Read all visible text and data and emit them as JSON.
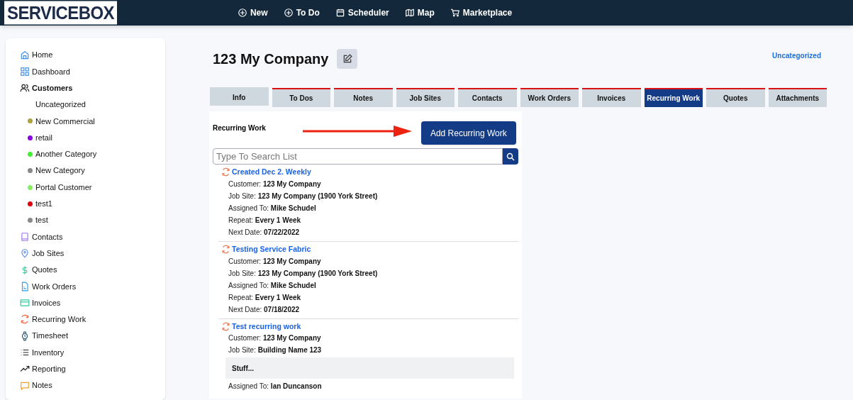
{
  "logo": "SERVICEBOX",
  "top_nav": [
    {
      "label": "New"
    },
    {
      "label": "To Do"
    },
    {
      "label": "Scheduler"
    },
    {
      "label": "Map"
    },
    {
      "label": "Marketplace"
    }
  ],
  "sidebar": {
    "items": [
      {
        "label": "Home",
        "selected": false
      },
      {
        "label": "Dashboard",
        "selected": false
      },
      {
        "label": "Customers",
        "selected": true,
        "children": [
          {
            "label": "Uncategorized"
          },
          {
            "label": "New Commercial",
            "color": "#b0a040"
          },
          {
            "label": "retail",
            "color": "#8a00e0"
          },
          {
            "label": "Another Category",
            "color": "#44ee33"
          },
          {
            "label": "New Category",
            "color": "#888888"
          },
          {
            "label": "Portal Customer",
            "color": "#88ee66"
          },
          {
            "label": "test1",
            "color": "#dd0011"
          },
          {
            "label": "test",
            "color": "#888888"
          }
        ]
      },
      {
        "label": "Contacts",
        "selected": false
      },
      {
        "label": "Job Sites",
        "selected": false
      },
      {
        "label": "Quotes",
        "selected": false
      },
      {
        "label": "Work Orders",
        "selected": false
      },
      {
        "label": "Invoices",
        "selected": false
      },
      {
        "label": "Recurring Work",
        "selected": false
      },
      {
        "label": "Timesheet",
        "selected": false
      },
      {
        "label": "Inventory",
        "selected": false
      },
      {
        "label": "Reporting",
        "selected": false
      },
      {
        "label": "Notes",
        "selected": false
      }
    ]
  },
  "header": {
    "title": "123 My Company",
    "category_link": "Uncategorized"
  },
  "tabs": [
    {
      "label": "Info",
      "selected": false,
      "flagged": false
    },
    {
      "label": "To Dos",
      "selected": false,
      "flagged": true
    },
    {
      "label": "Notes",
      "selected": false,
      "flagged": true
    },
    {
      "label": "Job Sites",
      "selected": false,
      "flagged": true
    },
    {
      "label": "Contacts",
      "selected": false,
      "flagged": true
    },
    {
      "label": "Work Orders",
      "selected": false,
      "flagged": true
    },
    {
      "label": "Invoices",
      "selected": false,
      "flagged": true
    },
    {
      "label": "Recurring Work",
      "selected": true,
      "flagged": true
    },
    {
      "label": "Quotes",
      "selected": false,
      "flagged": true
    },
    {
      "label": "Attachments",
      "selected": false,
      "flagged": true
    }
  ],
  "panel": {
    "title": "Recurring Work",
    "add_button": "Add Recurring Work",
    "search": {
      "placeholder": "Type To Search List"
    },
    "items": [
      {
        "title": "Created Dec 2. Weekly",
        "fields": [
          {
            "kind": "field",
            "label": "Customer:",
            "value": "123 My Company"
          },
          {
            "kind": "field",
            "label": "Job Site:",
            "value": "123 My Company (1900 York Street)"
          },
          {
            "kind": "field",
            "label": "Assigned To:",
            "value": "Mike Schudel"
          },
          {
            "kind": "field",
            "label": "Repeat:",
            "value": "Every 1 Week"
          },
          {
            "kind": "field",
            "label": "Next Date:",
            "value": "07/22/2022"
          }
        ]
      },
      {
        "title": "Testing Service Fabric",
        "fields": [
          {
            "kind": "field",
            "label": "Customer:",
            "value": "123 My Company"
          },
          {
            "kind": "field",
            "label": "Job Site:",
            "value": "123 My Company (1900 York Street)"
          },
          {
            "kind": "field",
            "label": "Assigned To:",
            "value": "Mike Schudel"
          },
          {
            "kind": "field",
            "label": "Repeat:",
            "value": "Every 1 Week"
          },
          {
            "kind": "field",
            "label": "Next Date:",
            "value": "07/18/2022"
          }
        ]
      },
      {
        "title": "Test recurring work",
        "fields": [
          {
            "kind": "field",
            "label": "Customer:",
            "value": "123 My Company"
          },
          {
            "kind": "field",
            "label": "Job Site:",
            "value": "Building Name 123"
          },
          {
            "kind": "note",
            "value": "Stuff..."
          },
          {
            "kind": "field",
            "label": "Assigned To:",
            "value": "Ian Duncanson"
          }
        ]
      }
    ]
  }
}
